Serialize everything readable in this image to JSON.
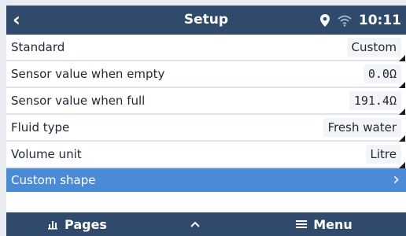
{
  "header": {
    "title": "Setup",
    "time": "10:11",
    "icons": [
      "chevron-left-icon",
      "location-pin-icon",
      "wifi-icon"
    ]
  },
  "settings": [
    {
      "label": "Standard",
      "value": "Custom"
    },
    {
      "label": "Sensor value when empty",
      "value": "0.0Ω"
    },
    {
      "label": "Sensor value when full",
      "value": "191.4Ω"
    },
    {
      "label": "Fluid type",
      "value": "Fresh water"
    },
    {
      "label": "Volume unit",
      "value": "Litre"
    }
  ],
  "selected_item": {
    "label": "Custom shape",
    "icon": "chevron-right-icon"
  },
  "footer": {
    "pages_label": "Pages",
    "menu_label": "Menu",
    "icons": [
      "chart-icon",
      "chevron-up-icon",
      "hamburger-icon"
    ]
  },
  "colors": {
    "header_bg": "#2f4a6a",
    "selected_bg": "#4b8bd6",
    "text": "#1f2a36"
  }
}
